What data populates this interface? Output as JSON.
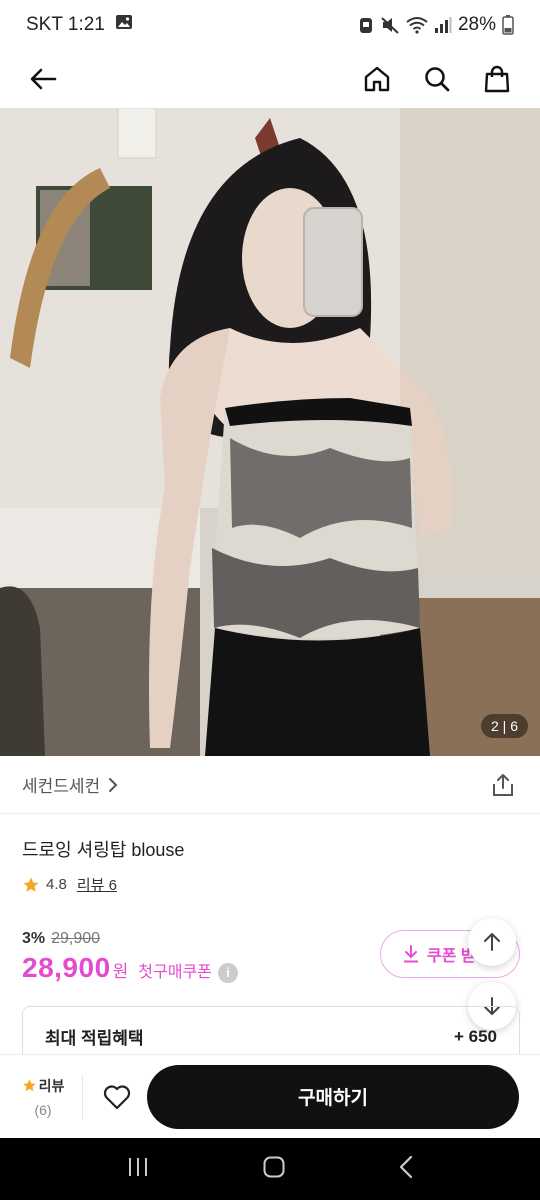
{
  "status_bar": {
    "carrier_time": "SKT 1:21",
    "battery": "28%"
  },
  "hero": {
    "page_indicator": "2 | 6"
  },
  "brand": {
    "name": "세컨드세컨"
  },
  "product": {
    "title": "드로잉 셔링탑 blouse",
    "rating": "4.8",
    "review_link": "리뷰 6"
  },
  "pricing": {
    "discount": "3%",
    "original_price": "29,900",
    "price": "28,900",
    "unit": "원",
    "coupon_label": "첫구매쿠폰",
    "coupon_button": "쿠폰 받"
  },
  "benefit": {
    "label": "최대 적립혜택",
    "value": "+ 650"
  },
  "bottom_bar": {
    "review_label": "리뷰",
    "review_count": "(6)",
    "buy_label": "구매하기"
  },
  "colors": {
    "accent": "#e54bd0",
    "star": "#f5a623",
    "buy_button": "#111111"
  },
  "icons": [
    "back-arrow-icon",
    "home-icon",
    "search-icon",
    "shopping-bag-icon",
    "chevron-right-icon",
    "share-icon",
    "star-icon",
    "info-icon",
    "download-icon",
    "arrow-up-icon",
    "arrow-down-icon",
    "heart-icon",
    "recent-apps-icon",
    "home-nav-icon",
    "back-nav-icon"
  ]
}
